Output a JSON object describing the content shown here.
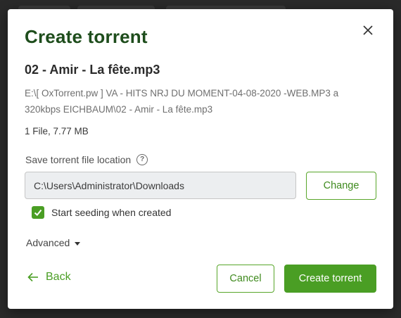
{
  "dialog": {
    "title": "Create torrent",
    "file_name": "02 - Amir - La fête.mp3",
    "file_path": "E:\\[ OxTorrent.pw ] VA - HITS NRJ DU MOMENT-04-08-2020 -WEB.MP3 a 320kbps EICHBAUM\\02 - Amir - La fête.mp3",
    "file_info": "1 File,  7.77 MB",
    "save_location_label": "Save torrent file location",
    "save_location_value": "C:\\Users\\Administrator\\Downloads",
    "change_label": "Change",
    "seed_label": "Start seeding when created",
    "seed_checked": true,
    "advanced_label": "Advanced",
    "back_label": "Back",
    "cancel_label": "Cancel",
    "create_label": "Create torrent"
  },
  "icons": {
    "close": "close-icon",
    "help": "help-icon",
    "check": "check-icon",
    "caret": "caret-down-icon",
    "back": "arrow-left-icon"
  },
  "colors": {
    "accent": "#4a9e24",
    "title": "#1e4d1c",
    "backdrop": "#2a2a2a"
  }
}
